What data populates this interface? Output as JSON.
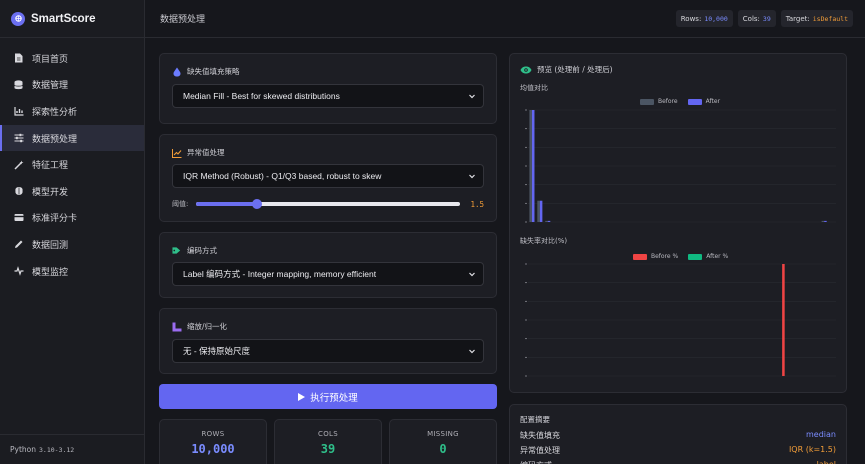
{
  "app": {
    "title": "SmartScore",
    "page_title": "数据预处理"
  },
  "header": {
    "chips": [
      {
        "label": "Rows:",
        "value": "10,000"
      },
      {
        "label": "Cols:",
        "value": "39"
      },
      {
        "label": "Target:",
        "value": "isDefault"
      }
    ]
  },
  "sidebar": {
    "items": [
      {
        "label": "项目首页",
        "icon": "file-icon"
      },
      {
        "label": "数据管理",
        "icon": "database-icon"
      },
      {
        "label": "探索性分析",
        "icon": "chart-icon"
      },
      {
        "label": "数据预处理",
        "icon": "sliders-icon",
        "active": true
      },
      {
        "label": "特征工程",
        "icon": "wand-icon"
      },
      {
        "label": "模型开发",
        "icon": "brain-icon"
      },
      {
        "label": "标准评分卡",
        "icon": "card-icon"
      },
      {
        "label": "数据回测",
        "icon": "pen-icon"
      },
      {
        "label": "模型监控",
        "icon": "pulse-icon"
      }
    ],
    "footer_label": "Python",
    "footer_version": "3.10-3.12"
  },
  "missing_fill": {
    "label": "缺失值填充策略",
    "selected": "Median Fill - Best for skewed distributions"
  },
  "outlier": {
    "label": "异常值处理",
    "selected": "IQR Method (Robust) - Q1/Q3 based, robust to skew",
    "threshold_label": "阈值:",
    "threshold_value": "1.5",
    "threshold_fraction": 0.23
  },
  "encoding": {
    "label": "编码方式",
    "selected": "Label 编码方式 - Integer mapping, memory efficient"
  },
  "scaling": {
    "label": "缩放/归一化",
    "selected": "无 - 保持原始尺度"
  },
  "run_button": "执行预处理",
  "stats": [
    {
      "label": "ROWS",
      "value": "10,000",
      "color": "#7a8cff"
    },
    {
      "label": "COLS",
      "value": "39",
      "color": "#2fbf8a"
    },
    {
      "label": "MISSING",
      "value": "0",
      "color": "#2fbf8a"
    }
  ],
  "preview": {
    "title": "预览 (处理前 / 处理后)",
    "mean_title": "均值对比",
    "missing_title": "缺失率对比(%)",
    "legend_before": "Before",
    "legend_after": "After",
    "legend_before_pct": "Before %",
    "legend_after_pct": "After %"
  },
  "summary": {
    "title": "配置摘要",
    "rows": [
      {
        "key": "缺失值填充",
        "value": "median"
      },
      {
        "key": "异常值处理",
        "value": "IQR (k=1.5)"
      },
      {
        "key": "编码方式",
        "value": "label"
      }
    ]
  },
  "colors": {
    "accent": "#6366f1",
    "before": "#4b5563",
    "after": "#6366f1",
    "missing_before": "#ef4444",
    "missing_after": "#10b981"
  },
  "chart_data": [
    {
      "type": "bar",
      "title": "均值对比",
      "series": [
        {
          "name": "Before",
          "values": [
            1.0,
            0.19,
            0.01,
            0.0,
            0.0,
            0.0,
            0.0,
            0.0,
            0.0,
            0.0,
            0.0,
            0.0,
            0.0,
            0.0,
            0.0,
            0.0,
            0.0,
            0.0,
            0.0,
            0.0,
            0.0,
            0.0,
            0.0,
            0.0,
            0.0,
            0.0,
            0.0,
            0.0,
            0.0,
            0.0,
            0.0,
            0.0,
            0.0,
            0.0,
            0.0,
            0.0,
            0.0,
            0.01,
            0.0
          ]
        },
        {
          "name": "After",
          "values": [
            1.0,
            0.19,
            0.01,
            0.0,
            0.0,
            0.0,
            0.0,
            0.0,
            0.0,
            0.0,
            0.0,
            0.0,
            0.0,
            0.0,
            0.0,
            0.0,
            0.0,
            0.0,
            0.0,
            0.0,
            0.0,
            0.0,
            0.0,
            0.0,
            0.0,
            0.0,
            0.0,
            0.0,
            0.0,
            0.0,
            0.0,
            0.0,
            0.0,
            0.0,
            0.0,
            0.0,
            0.0,
            0.01,
            0.0
          ]
        }
      ],
      "legend": "top-center",
      "grid": true
    },
    {
      "type": "bar",
      "title": "缺失率对比(%)",
      "series": [
        {
          "name": "Before %",
          "values": [
            0,
            0,
            0,
            0,
            0,
            0,
            0,
            0,
            0,
            0,
            0,
            0,
            0,
            0,
            0,
            0,
            0,
            0,
            0,
            0,
            0,
            0,
            0,
            0,
            0,
            0,
            0,
            0,
            0,
            0,
            0,
            0,
            1.0,
            0,
            0,
            0,
            0,
            0,
            0
          ]
        },
        {
          "name": "After %",
          "values": [
            0,
            0,
            0,
            0,
            0,
            0,
            0,
            0,
            0,
            0,
            0,
            0,
            0,
            0,
            0,
            0,
            0,
            0,
            0,
            0,
            0,
            0,
            0,
            0,
            0,
            0,
            0,
            0,
            0,
            0,
            0,
            0,
            0,
            0,
            0,
            0,
            0,
            0,
            0
          ]
        }
      ],
      "legend": "top-center",
      "grid": true
    }
  ]
}
